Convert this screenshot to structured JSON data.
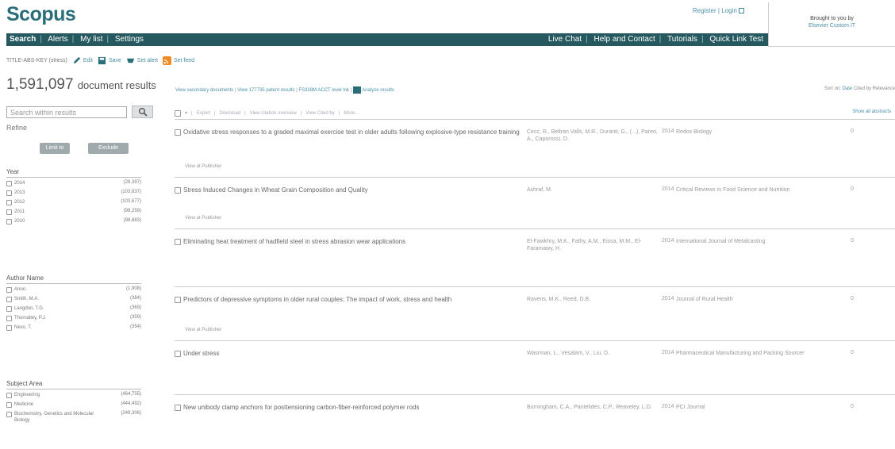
{
  "header": {
    "logo": "Scopus",
    "top_links": [
      "Register",
      "Login"
    ],
    "brought_line1": "Brought to you by",
    "brought_line2": "Elsevier Custom IT"
  },
  "nav": {
    "left": [
      "Search",
      "Alerts",
      "My list",
      "Settings"
    ],
    "right": [
      "Live Chat",
      "Help and Contact",
      "Tutorials",
      "Quick Link Test"
    ]
  },
  "toolbar": {
    "query": "TITLE-ABS-KEY (stress)",
    "edit": "Edit",
    "save": "Save",
    "set_alert": "Set alert",
    "set_feed": "Set feed"
  },
  "results_summary": {
    "count": "1,591,097",
    "label": "document results",
    "links": [
      "View secondary documents",
      "View 177735 patent results",
      "FS328M ACCT level lnk"
    ],
    "analyze": "Analyze results",
    "sort_label": "Sort on:",
    "sort_options": [
      "Date",
      "Cited by",
      "Relevance"
    ]
  },
  "sidebar": {
    "search_placeholder": "Search within results",
    "refine": "Refine",
    "limit_to": "Limit to",
    "exclude": "Exclude",
    "year": {
      "title": "Year",
      "items": [
        {
          "name": "2014",
          "count": "(28,397)"
        },
        {
          "name": "2013",
          "count": "(103,837)"
        },
        {
          "name": "2012",
          "count": "(103,677)"
        },
        {
          "name": "2011",
          "count": "(98,259)"
        },
        {
          "name": "2010",
          "count": "(98,883)"
        }
      ]
    },
    "author": {
      "title": "Author Name",
      "items": [
        {
          "name": "Anon.",
          "count": "(1,908)"
        },
        {
          "name": "Smith, M.A.",
          "count": "(384)"
        },
        {
          "name": "Langdon, T.G.",
          "count": "(369)"
        },
        {
          "name": "Thornalley, P.J.",
          "count": "(359)"
        },
        {
          "name": "Nevo, T.",
          "count": "(354)"
        }
      ]
    },
    "subject": {
      "title": "Subject Area",
      "items": [
        {
          "name": "Engineering",
          "count": "(464,755)"
        },
        {
          "name": "Medicine",
          "count": "(444,492)"
        },
        {
          "name": "Biochemistry, Genetics and Molecular Biology",
          "count": "(249,306)"
        }
      ]
    }
  },
  "list_toolbar": {
    "items": [
      "Export",
      "Download",
      "View citation overview",
      "View Cited by",
      "More..."
    ],
    "show_all": "Show all abstracts"
  },
  "results": [
    {
      "title": "Oxidative stress responses to a graded maximal exercise test in older adults following explosive-type resistance training",
      "authors": "Cecc, R., Beltran Valls, M.R., Duranti, G., (...), Pareo, A., Caporossi, D.",
      "year": "2014",
      "source": "Redox Biology",
      "cited": "0",
      "publisher": "View at Publisher"
    },
    {
      "title": "Stress Induced Changes in Wheat Grain Composition and Quality",
      "authors": "Ashraf, M.",
      "year": "2014",
      "source": "Critical Reviews in Food Science and Nutrition",
      "cited": "0",
      "publisher": "View at Publisher"
    },
    {
      "title": "Eliminating heat treatment of hadfield steel in stress abrasion wear applications",
      "authors": "El-Fawkhry, M.K., Fathy, A.M., Eissa, M.M., El-Faramawy, H.",
      "year": "2014",
      "source": "International Journal of Metalcasting",
      "cited": "0",
      "publisher": ""
    },
    {
      "title": "Predictors of depressive symptoms in older rural couples: The impact of work, stress and health",
      "authors": "Ravens, M.K., Reed, D.B.",
      "year": "2014",
      "source": "Journal of Rural Health",
      "cited": "0",
      "publisher": "View at Publisher"
    },
    {
      "title": "Under stress",
      "authors": "Wasrman, L., Vesalam, V., Liu, D.",
      "year": "2014",
      "source": "Pharmaceutical Manufacturing and Packing Sourcer",
      "cited": "0",
      "publisher": ""
    },
    {
      "title": "New unibody clamp anchors for posttensioning carbon-fiber-reinforced polymer rods",
      "authors": "Burningham, C.A., Pantelides, C.P., Reaveley, L.D.",
      "year": "2014",
      "source": "PCI Journal",
      "cited": "0",
      "publisher": ""
    }
  ],
  "colors": {
    "brand": "#2a6e7a",
    "navbar": "#25595f",
    "link": "#4a8fa8"
  }
}
